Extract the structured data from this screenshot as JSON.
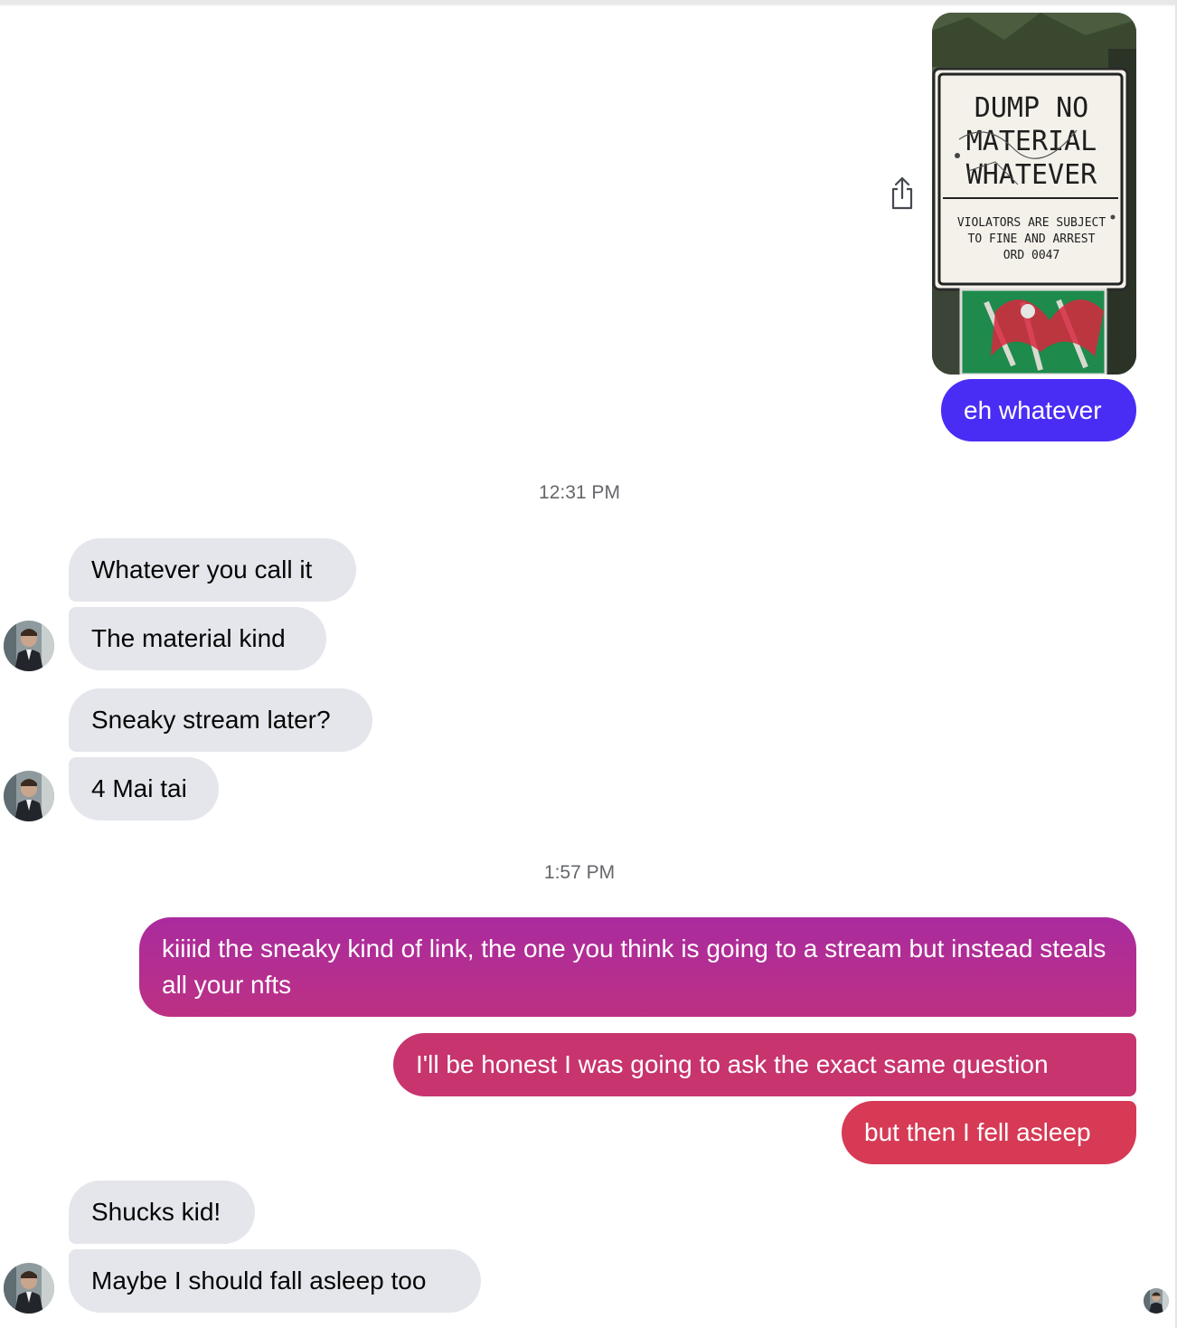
{
  "attachment": {
    "sign_lines": [
      "DUMP NO",
      "MATERIAL",
      "WHATEVER"
    ],
    "sign_small_lines": [
      "VIOLATORS ARE SUBJECT",
      "TO FINE AND ARREST",
      "ORD 0047"
    ]
  },
  "timestamps": [
    "12:31 PM",
    "1:57 PM"
  ],
  "messages": [
    {
      "text": "eh whatever",
      "color": "#4a2df5"
    },
    {
      "text": "Whatever you call it"
    },
    {
      "text": "The material kind"
    },
    {
      "text": "Sneaky stream later?"
    },
    {
      "text": "4 Mai tai"
    },
    {
      "text": "kiiiid the sneaky kind of link, the one you think is going to a stream but instead steals all your nfts",
      "color": "#b02c96"
    },
    {
      "text": "I'll be honest I was going to ask the exact same question",
      "color": "#c7356e"
    },
    {
      "text": "but then I fell asleep",
      "color": "#d63a55"
    },
    {
      "text": "Shucks kid!"
    },
    {
      "text": "Maybe I should fall asleep too"
    }
  ],
  "icons": {
    "share": "share-icon",
    "avatar": "contact-avatar"
  }
}
